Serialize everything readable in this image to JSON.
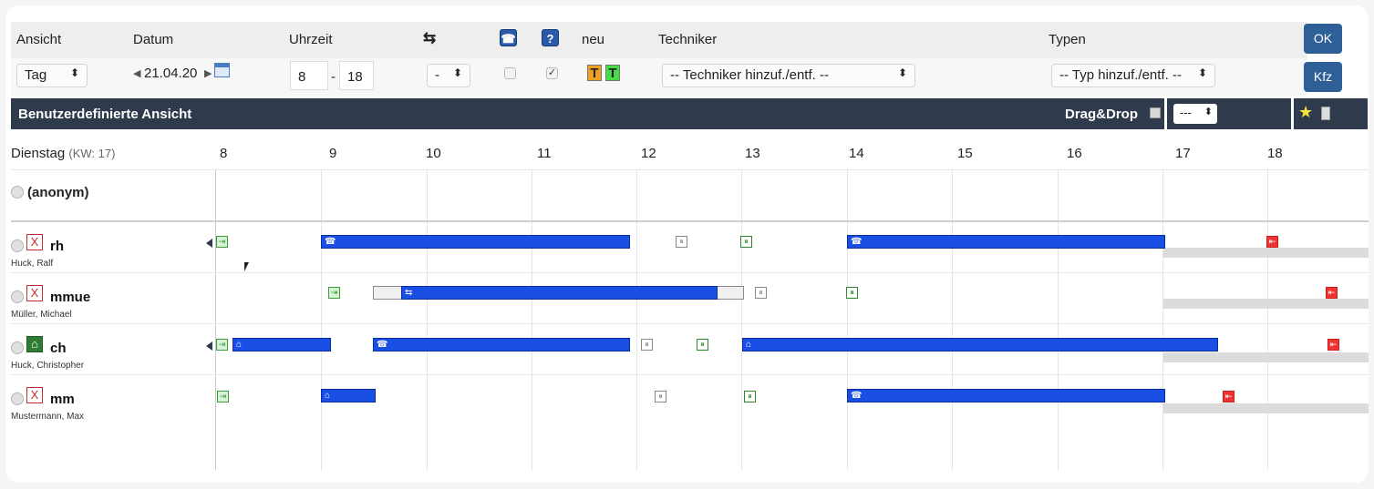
{
  "toolbar": {
    "labels": {
      "ansicht": "Ansicht",
      "datum": "Datum",
      "uhrzeit": "Uhrzeit",
      "neu": "neu",
      "techniker": "Techniker",
      "typen": "Typen"
    },
    "ansicht_value": "Tag",
    "date_value": "21.04.20",
    "time_from": "8",
    "time_separator": "-",
    "time_to": "18",
    "filter_value": "-",
    "techniker_select": "-- Techniker hinzuf./entf. --",
    "typ_select": "-- Typ hinzuf./entf. --",
    "ok_label": "OK",
    "kfz_label": "Kfz",
    "tech_button_letter": "T",
    "help_glyph": "?",
    "colors": {
      "orange": "#f0a020",
      "green": "#44dd44",
      "blue_button": "#2f5f97"
    }
  },
  "viewbar": {
    "title": "Benutzerdefinierte Ansicht",
    "dragdrop_label": "Drag&Drop",
    "view_select": "---",
    "bg_color": "#2f3a4c"
  },
  "gantt": {
    "day_label": "Dienstag",
    "kw_label": "(KW: 17)",
    "hours": [
      "8",
      "9",
      "10",
      "11",
      "12",
      "13",
      "14",
      "15",
      "16",
      "17",
      "18"
    ],
    "anonymous_label": "(anonym)",
    "bar_color": "#1a4fe6",
    "resources": [
      {
        "code": "rh",
        "name": "Huck, Ralf",
        "icon": "x-icon"
      },
      {
        "code": "mmue",
        "name": "Müller, Michael",
        "icon": "x-icon"
      },
      {
        "code": "ch",
        "name": "Huck, Christopher",
        "icon": "home-icon"
      },
      {
        "code": "mm",
        "name": "Mustermann, Max",
        "icon": "x-icon"
      }
    ]
  }
}
